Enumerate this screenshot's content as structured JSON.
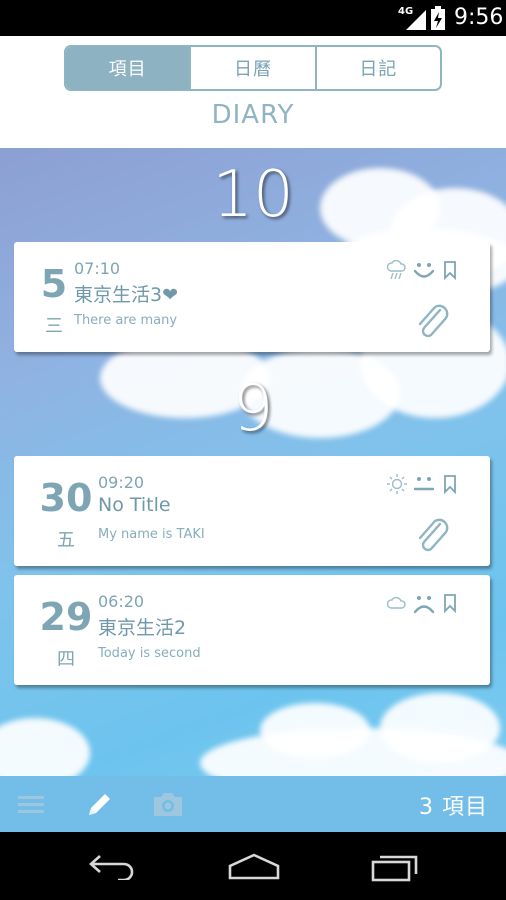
{
  "status_bar": {
    "network": "4G",
    "time": "9:56"
  },
  "header": {
    "tabs": [
      {
        "label": "項目",
        "active": true
      },
      {
        "label": "日曆",
        "active": false
      },
      {
        "label": "日記",
        "active": false
      }
    ],
    "title": "DIARY"
  },
  "groups": [
    {
      "month": "10",
      "entries": [
        {
          "day": "5",
          "weekday": "三",
          "time": "07:10",
          "title": "東京生活3❤",
          "preview": "There are many",
          "weather_icon": "rain-icon",
          "mood_icon": "happy-face-icon",
          "bookmark_icon": "bookmark-icon",
          "attachment": true
        }
      ]
    },
    {
      "month": "9",
      "entries": [
        {
          "day": "30",
          "weekday": "五",
          "time": "09:20",
          "title": "No Title",
          "preview": "My name is TAKI",
          "weather_icon": "sun-icon",
          "mood_icon": "neutral-face-icon",
          "bookmark_icon": "bookmark-icon",
          "attachment": true
        },
        {
          "day": "29",
          "weekday": "四",
          "time": "06:20",
          "title": "東京生活2",
          "preview": "Today is second",
          "weather_icon": "cloud-icon",
          "mood_icon": "sad-face-icon",
          "bookmark_icon": "bookmark-icon",
          "attachment": false
        }
      ]
    }
  ],
  "toolbar": {
    "icons": [
      "menu-icon",
      "pencil-icon",
      "camera-icon"
    ],
    "count_label": "3 項目"
  },
  "navbar": {
    "icons": [
      "back-icon",
      "home-icon",
      "recent-apps-icon"
    ]
  },
  "colors": {
    "accent": "#8fb4c4",
    "toolbar": "#73bde9",
    "text": "#7ea5b4"
  }
}
